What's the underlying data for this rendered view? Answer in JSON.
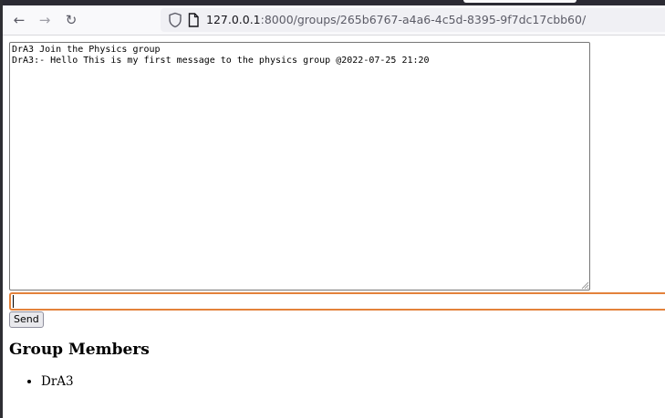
{
  "browser": {
    "url_host": "127.0.0.1",
    "url_path": ":8000/groups/265b6767-a4a6-4c5d-8395-9f7dc17cbb60/",
    "icons": {
      "back": "back-arrow-icon",
      "forward": "forward-arrow-icon",
      "reload": "reload-icon",
      "tracking_protection": "shield-icon",
      "page_info": "page-icon"
    }
  },
  "chat": {
    "log_text": "DrA3 Join the Physics group\nDrA3:- Hello This is my first message to the physics group @2022-07-25 21:20",
    "input_value": "",
    "send_label": "Send"
  },
  "members": {
    "heading": "Group Members",
    "items": [
      "DrA3"
    ]
  },
  "colors": {
    "input_focus_border": "#e3823b",
    "toolbar_bg": "#f9f9fb",
    "urlbar_bg": "#f0f0f4"
  }
}
